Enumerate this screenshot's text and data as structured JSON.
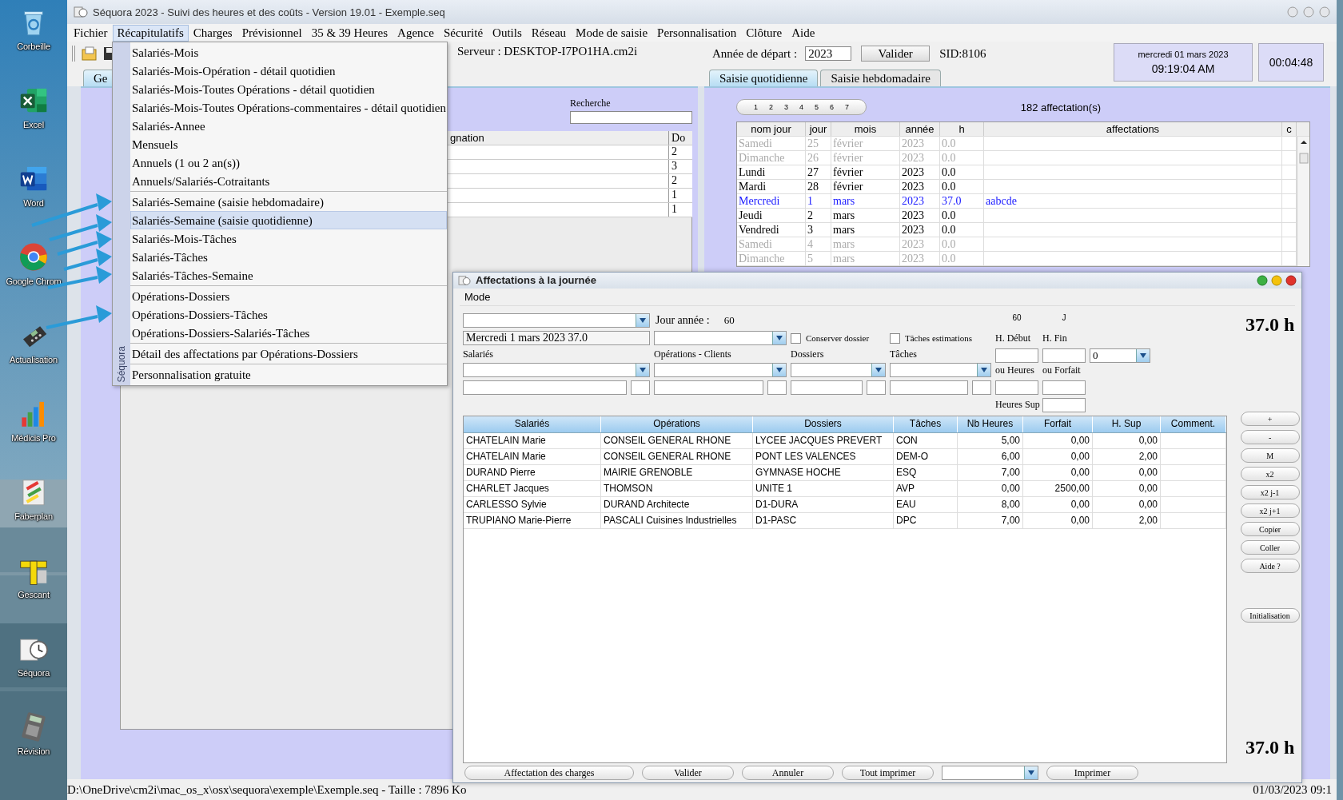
{
  "desktop_icons": [
    {
      "label": "Corbeille",
      "kind": "recycle"
    },
    {
      "label": "Excel",
      "kind": "excel"
    },
    {
      "label": "Word",
      "kind": "word"
    },
    {
      "label": "Google Chrom",
      "kind": "chrome"
    },
    {
      "label": "Actualisation",
      "kind": "terminal"
    },
    {
      "label": "Médicis Pro",
      "kind": "chart"
    },
    {
      "label": "Faberplan",
      "kind": "planner"
    },
    {
      "label": "Gescant",
      "kind": "ruler"
    },
    {
      "label": "Séquora",
      "kind": "clock"
    },
    {
      "label": "Révision",
      "kind": "calculator"
    }
  ],
  "window": {
    "title": "Séquora 2023 - Suivi des heures et des coûts - Version 19.01 - Exemple.seq"
  },
  "menubar": [
    {
      "label": "Fichier",
      "selected": false
    },
    {
      "label": "Récapitulatifs",
      "selected": true
    },
    {
      "label": "Charges",
      "selected": false
    },
    {
      "label": "Prévisionnel",
      "selected": false
    },
    {
      "label": "35 & 39 Heures",
      "selected": false
    },
    {
      "label": "Agence",
      "selected": false
    },
    {
      "label": "Sécurité",
      "selected": false
    },
    {
      "label": "Outils",
      "selected": false
    },
    {
      "label": "Réseau",
      "selected": false
    },
    {
      "label": "Mode de saisie",
      "selected": false
    },
    {
      "label": "Personnalisation",
      "selected": false
    },
    {
      "label": "Clôture",
      "selected": false
    },
    {
      "label": "Aide",
      "selected": false
    }
  ],
  "server": "Serveur : DESKTOP-I7PO1HA.cm2i",
  "start_year": {
    "label": "Année de départ :",
    "value": "2023",
    "button": "Valider",
    "sid": "SID:8106"
  },
  "clock": {
    "date": "mercredi 01 mars 2023",
    "time": "09:19:04 AM",
    "elapsed": "00:04:48"
  },
  "left_panel": {
    "tabs": [
      {
        "label": "Ge",
        "selected": true
      }
    ],
    "search": {
      "label": "Recherche"
    },
    "table": {
      "columns": [
        "gnation",
        "Do"
      ],
      "rows": [
        "2",
        "3",
        "2",
        "1",
        "1"
      ]
    }
  },
  "recap_menu": {
    "side_label": "Séquora",
    "groups": [
      [
        {
          "label": "Salariés-Mois",
          "selected": false
        },
        {
          "label": "Salariés-Mois-Opération - détail quotidien",
          "selected": false
        },
        {
          "label": "Salariés-Mois-Toutes Opérations - détail quotidien",
          "selected": false
        },
        {
          "label": "Salariés-Mois-Toutes Opérations-commentaires - détail quotidien",
          "selected": false
        },
        {
          "label": "Salariés-Annee",
          "selected": false
        },
        {
          "label": "Mensuels",
          "selected": false
        },
        {
          "label": "Annuels (1 ou 2 an(s))",
          "selected": false
        },
        {
          "label": "Annuels/Salariés-Cotraitants",
          "selected": false
        }
      ],
      [
        {
          "label": "Salariés-Semaine (saisie hebdomadaire)",
          "selected": false
        },
        {
          "label": "Salariés-Semaine (saisie quotidienne)",
          "selected": true
        },
        {
          "label": "Salariés-Mois-Tâches",
          "selected": false
        },
        {
          "label": "Salariés-Tâches",
          "selected": false
        },
        {
          "label": "Salariés-Tâches-Semaine",
          "selected": false
        }
      ],
      [
        {
          "label": "Opérations-Dossiers",
          "selected": false
        },
        {
          "label": "Opérations-Dossiers-Tâches",
          "selected": false
        },
        {
          "label": "Opérations-Dossiers-Salariés-Tâches",
          "selected": false
        }
      ],
      [
        {
          "label": "Détail des affectations par Opérations-Dossiers",
          "selected": false
        }
      ],
      [
        {
          "label": "Personnalisation gratuite",
          "selected": false
        }
      ]
    ]
  },
  "right_panel": {
    "tabs": [
      {
        "label": "Saisie quotidienne",
        "selected": true
      },
      {
        "label": "Saisie hebdomadaire",
        "selected": false
      }
    ],
    "pages": [
      "1",
      "2",
      "3",
      "4",
      "5",
      "6",
      "7"
    ],
    "count": "182 affectation(s)",
    "table": {
      "columns": [
        "nom jour",
        "jour",
        "mois",
        "année",
        "h",
        "affectations",
        "c"
      ],
      "rows": [
        {
          "kind": "weekend",
          "cells": [
            "Samedi",
            "25",
            "février",
            "2023",
            "0.0"
          ]
        },
        {
          "kind": "weekend",
          "cells": [
            "Dimanche",
            "26",
            "février",
            "2023",
            "0.0"
          ]
        },
        {
          "kind": "weekday",
          "cells": [
            "Lundi",
            "27",
            "février",
            "2023",
            "0.0"
          ]
        },
        {
          "kind": "weekday",
          "cells": [
            "Mardi",
            "28",
            "février",
            "2023",
            "0.0"
          ]
        },
        {
          "kind": "current",
          "cells": [
            "Mercredi",
            "1",
            "mars",
            "2023",
            "37.0",
            "aabcde"
          ]
        },
        {
          "kind": "weekday",
          "cells": [
            "Jeudi",
            "2",
            "mars",
            "2023",
            "0.0"
          ]
        },
        {
          "kind": "weekday",
          "cells": [
            "Vendredi",
            "3",
            "mars",
            "2023",
            "0.0"
          ]
        },
        {
          "kind": "weekend",
          "cells": [
            "Samedi",
            "4",
            "mars",
            "2023",
            "0.0"
          ]
        },
        {
          "kind": "weekend",
          "cells": [
            "Dimanche",
            "5",
            "mars",
            "2023",
            "0.0"
          ]
        }
      ]
    }
  },
  "dialog": {
    "title": "Affectations à la journée",
    "menu": [
      "Mode"
    ],
    "day_of_year": {
      "label": "Jour année :",
      "value": "60"
    },
    "day_number": "60",
    "day_unit": "J",
    "total_top": "37.0 h",
    "date_field": "Mercredi 1 mars 2023 37.0",
    "checkboxes": [
      {
        "label": "Conserver dossier",
        "checked": false
      },
      {
        "label": "Tâches estimations",
        "checked": false
      }
    ],
    "field_labels": [
      "Salariés",
      "Opérations - Clients",
      "Dossiers",
      "Tâches"
    ],
    "time_labels": {
      "start": "H. Début",
      "end": "H. Fin",
      "hours": "ou Heures",
      "flat": "ou Forfait",
      "overtime": "Heures Sup"
    },
    "mode_combo": "0",
    "table": {
      "columns": [
        "Salariés",
        "Opérations",
        "Dossiers",
        "Tâches",
        "Nb Heures",
        "Forfait",
        "H. Sup",
        "Comment."
      ],
      "rows": [
        [
          "CHATELAIN Marie",
          "CONSEIL GENERAL RHONE",
          "LYCEE JACQUES PREVERT",
          "CON",
          "5,00",
          "0,00",
          "0,00"
        ],
        [
          "CHATELAIN Marie",
          "CONSEIL GENERAL RHONE",
          "PONT LES VALENCES",
          "DEM-O",
          "6,00",
          "0,00",
          "2,00"
        ],
        [
          "DURAND Pierre",
          "MAIRIE GRENOBLE",
          "GYMNASE HOCHE",
          "ESQ",
          "7,00",
          "0,00",
          "0,00"
        ],
        [
          "CHARLET Jacques",
          "THOMSON",
          "UNITE 1",
          "AVP",
          "0,00",
          "2500,00",
          "0,00"
        ],
        [
          "CARLESSO Sylvie",
          "DURAND Architecte",
          "D1-DURA",
          "EAU",
          "8,00",
          "0,00",
          "0,00"
        ],
        [
          "TRUPIANO Marie-Pierre",
          "PASCALI Cuisines Industrielles",
          "D1-PASC",
          "DPC",
          "7,00",
          "0,00",
          "2,00"
        ]
      ]
    },
    "side_buttons": [
      "+",
      "-",
      "M",
      "x2",
      "x2 j-1",
      "x2 j+1",
      "Copier",
      "Coller",
      "Aide ?"
    ],
    "init_button": "Initialisation",
    "total_bottom": "37.0 h",
    "bottom_buttons": [
      "Affectation des charges",
      "Valider",
      "Annuler",
      "Tout imprimer"
    ],
    "print_button": "Imprimer"
  },
  "status_bar": {
    "path": "D:\\OneDrive\\cm2i\\mac_os_x\\osx\\sequora\\exemple\\Exemple.seq   -   Taille : 7896 Ko",
    "date": "01/03/2023 09:1"
  }
}
